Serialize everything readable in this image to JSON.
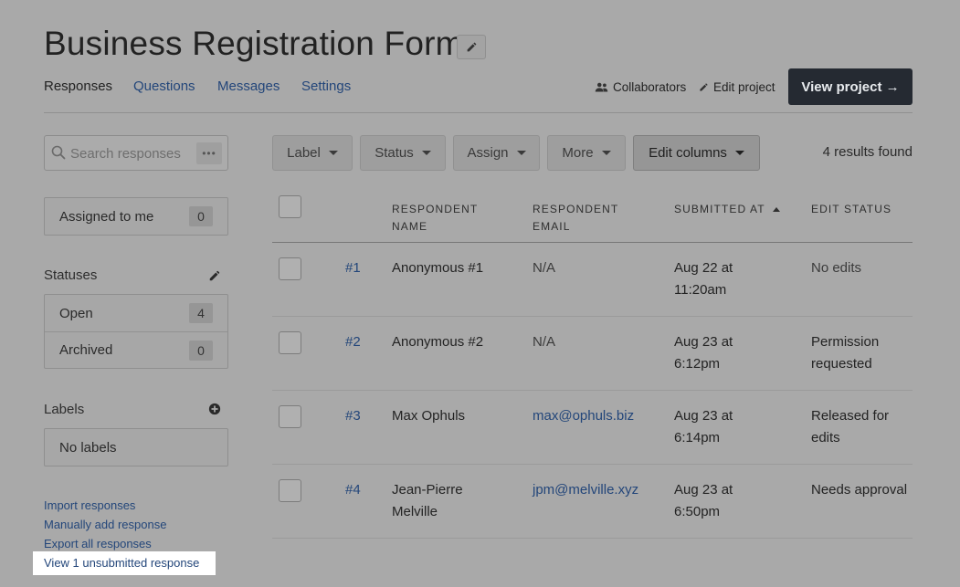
{
  "header": {
    "title": "Business Registration Form",
    "tabs": [
      "Responses",
      "Questions",
      "Messages",
      "Settings"
    ],
    "collaborators_label": "Collaborators",
    "edit_project_label": "Edit project",
    "view_project_label": "View project →"
  },
  "sidebar": {
    "search_placeholder": "Search responses",
    "search_more": "•••",
    "assigned_to_me": {
      "label": "Assigned to me",
      "count": "0"
    },
    "statuses_title": "Statuses",
    "statuses": [
      {
        "label": "Open",
        "count": "4"
      },
      {
        "label": "Archived",
        "count": "0"
      }
    ],
    "labels_title": "Labels",
    "no_labels": "No labels",
    "links": [
      "Import responses",
      "Manually add response",
      "Export all responses",
      "View 1 unsubmitted response"
    ]
  },
  "toolbar": {
    "buttons": [
      "Label",
      "Status",
      "Assign",
      "More",
      "Edit columns"
    ],
    "results": "4 results found"
  },
  "table": {
    "headers": {
      "name_line1": "RESPONDENT",
      "name_line2": "NAME",
      "email_line1": "RESPONDENT",
      "email_line2": "EMAIL",
      "submitted": "SUBMITTED AT",
      "edit_status": "EDIT STATUS"
    },
    "rows": [
      {
        "num": "#1",
        "name1": "Anonymous #1",
        "name2": "",
        "email": "N/A",
        "date1": "Aug 22 at",
        "date2": "11:20am",
        "status1": "No edits",
        "status2": ""
      },
      {
        "num": "#2",
        "name1": "Anonymous #2",
        "name2": "",
        "email": "N/A",
        "date1": "Aug 23 at",
        "date2": "6:12pm",
        "status1": "Permission",
        "status2": "requested"
      },
      {
        "num": "#3",
        "name1": "Max Ophuls",
        "name2": "",
        "email": "max@ophuls.biz",
        "date1": "Aug 23 at",
        "date2": "6:14pm",
        "status1": "Released for",
        "status2": "edits"
      },
      {
        "num": "#4",
        "name1": "Jean-Pierre",
        "name2": "Melville",
        "email": "jpm@melville.xyz",
        "date1": "Aug 23 at",
        "date2": "6:50pm",
        "status1": "Needs approval",
        "status2": ""
      }
    ]
  }
}
